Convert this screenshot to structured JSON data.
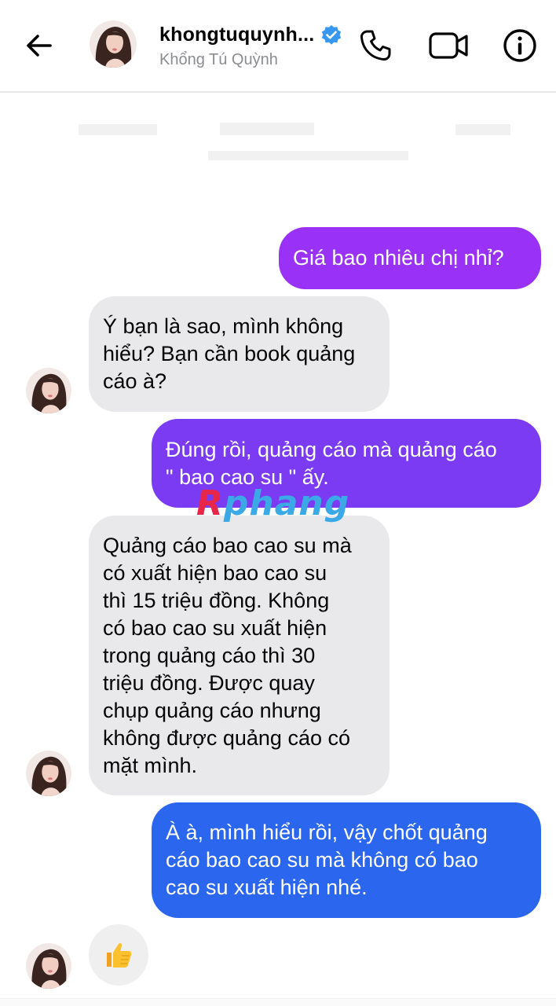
{
  "header": {
    "title": "khongtuquynh...",
    "subtitle": "Khổng Tú Quỳnh",
    "verified": true,
    "icons": [
      "back-arrow-icon",
      "verified-badge-icon",
      "phone-icon",
      "video-camera-icon",
      "info-icon"
    ]
  },
  "messages": [
    {
      "sender": "me",
      "text": "Giá bao nhiêu chị nhỉ?"
    },
    {
      "sender": "them",
      "text": "Ý bạn là sao, mình không\nhiểu? Bạn cần book quảng\ncáo à?"
    },
    {
      "sender": "me",
      "text": "Đúng rồi, quảng cáo mà quảng cáo\n\" bao cao su \" ấy."
    },
    {
      "sender": "them",
      "text": "Quảng cáo bao cao su mà\ncó xuất hiện bao cao su\nthì 15 triệu đồng.  Không\ncó bao cao su xuất hiện\ntrong quảng cáo thì 30\ntriệu đồng. Được quay\nchụp quảng cáo nhưng\nkhông được quảng cáo có\nmặt mình."
    },
    {
      "sender": "me",
      "text": "À à, mình hiểu rồi, vậy chốt quảng\ncáo bao cao su mà không có bao\ncao su xuất hiện nhé."
    },
    {
      "sender": "them",
      "reaction": "👍"
    }
  ],
  "watermark": {
    "first": "R",
    "rest": "phang"
  },
  "colors": {
    "sent_top": "#a033ff",
    "sent_mid": "#6b3cf0",
    "sent_bottom": "#1d6ef0",
    "received": "#e9e9eb",
    "verified": "#3897f0"
  }
}
